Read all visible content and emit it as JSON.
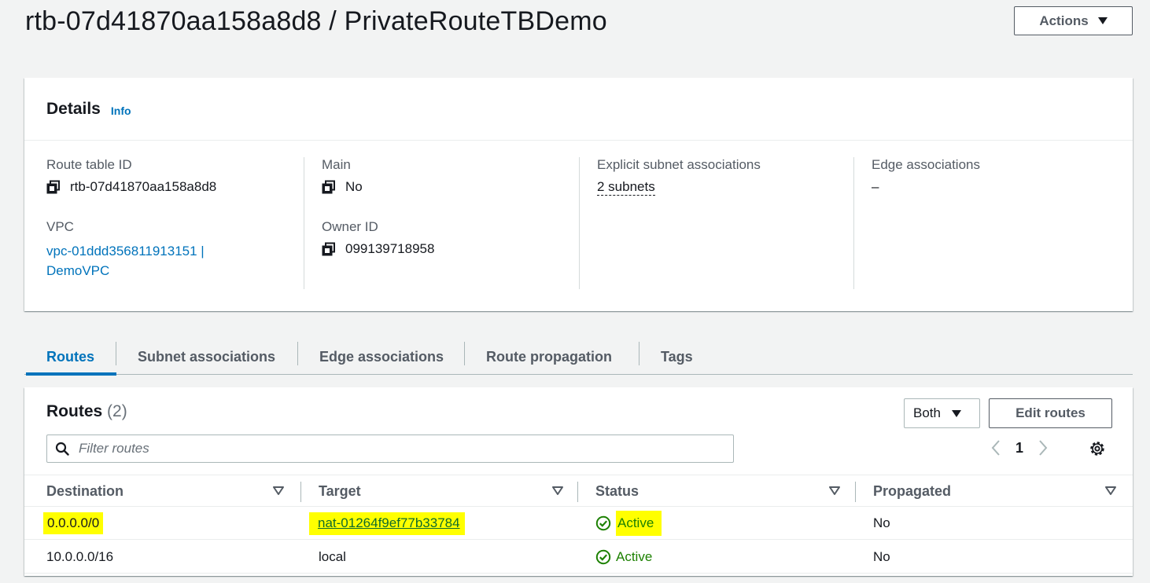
{
  "header": {
    "title": "rtb-07d41870aa158a8d8 / PrivateRouteTBDemo",
    "actions_label": "Actions"
  },
  "details": {
    "title": "Details",
    "info": "Info",
    "route_table_id_label": "Route table ID",
    "route_table_id": "rtb-07d41870aa158a8d8",
    "vpc_label": "VPC",
    "vpc_line1": "vpc-01ddd356811913151 |",
    "vpc_line2": "DemoVPC",
    "main_label": "Main",
    "main_value": "No",
    "owner_label": "Owner ID",
    "owner_value": "099139718958",
    "subnet_assoc_label": "Explicit subnet associations",
    "subnet_assoc_value": "2 subnets",
    "edge_assoc_label": "Edge associations",
    "edge_assoc_value": "–"
  },
  "tabs": [
    {
      "label": "Routes",
      "active": true
    },
    {
      "label": "Subnet associations"
    },
    {
      "label": "Edge associations"
    },
    {
      "label": "Route propagation"
    },
    {
      "label": "Tags"
    }
  ],
  "routes": {
    "title": "Routes",
    "count": "(2)",
    "filter_select": "Both",
    "edit_label": "Edit routes",
    "filter_placeholder": "Filter routes",
    "page": "1",
    "columns": [
      "Destination",
      "Target",
      "Status",
      "Propagated"
    ],
    "rows": [
      {
        "destination": "0.0.0.0/0",
        "target": "nat-01264f9ef77b33784",
        "status": "Active",
        "propagated": "No"
      },
      {
        "destination": "10.0.0.0/16",
        "target": "local",
        "status": "Active",
        "propagated": "No"
      }
    ]
  },
  "colors": {
    "link": "#0073bb",
    "success": "#1d8102",
    "highlight": "#ffff00"
  }
}
